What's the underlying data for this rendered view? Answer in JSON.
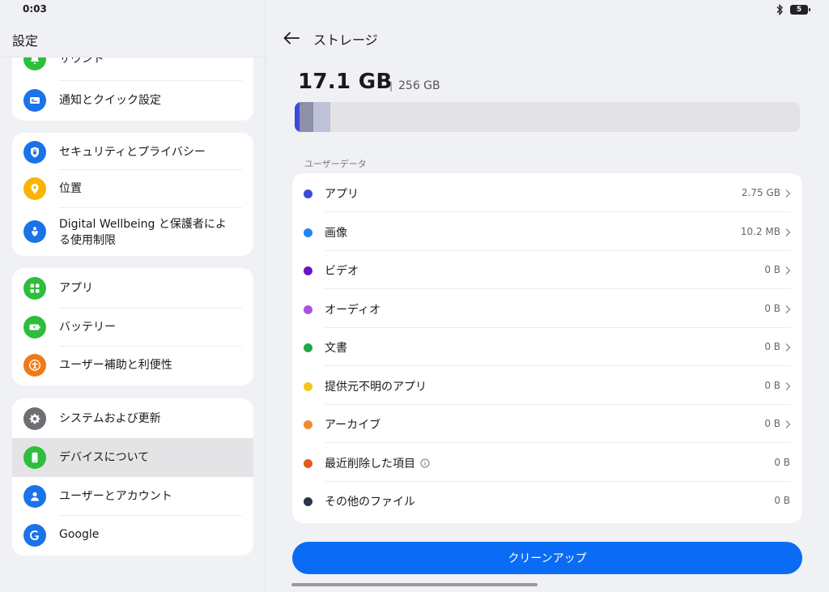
{
  "status_bar": {
    "time": "0:03",
    "battery": "5"
  },
  "left": {
    "title": "設定",
    "cards": [
      {
        "items": [
          {
            "label": "サウンド",
            "icon": "bell-icon",
            "color": "#2dbe3c"
          },
          {
            "label": "通知とクイック設定",
            "icon": "notification-icon",
            "color": "#1a73e8"
          }
        ]
      },
      {
        "items": [
          {
            "label": "セキュリティとプライバシー",
            "icon": "shield-icon",
            "color": "#1a73e8"
          },
          {
            "label": "位置",
            "icon": "location-icon",
            "color": "#f7b500"
          },
          {
            "label": "Digital Wellbeing と保護者による使用制限",
            "icon": "wellbeing-icon",
            "color": "#1a73e8"
          }
        ]
      },
      {
        "items": [
          {
            "label": "アプリ",
            "icon": "apps-icon",
            "color": "#2dbe3c"
          },
          {
            "label": "バッテリー",
            "icon": "battery-icon",
            "color": "#2dbe3c"
          },
          {
            "label": "ユーザー補助と利便性",
            "icon": "accessibility-icon",
            "color": "#f07a1a"
          }
        ]
      },
      {
        "items": [
          {
            "label": "システムおよび更新",
            "icon": "gear-icon",
            "color": "#6e6e73"
          },
          {
            "label": "デバイスについて",
            "icon": "phone-icon",
            "color": "#2dbe3c"
          },
          {
            "label": "ユーザーとアカウント",
            "icon": "person-icon",
            "color": "#1a73e8"
          },
          {
            "label": "Google",
            "icon": "google-icon",
            "color": "#1a73e8"
          }
        ]
      }
    ]
  },
  "right": {
    "title": "ストレージ",
    "used": "17.1 GB",
    "separator": "|",
    "total": "256 GB",
    "section_label": "ユーザーデータ",
    "items": [
      {
        "label": "アプリ",
        "size": "2.75 GB",
        "color": "#3a4bd8",
        "chevron": true
      },
      {
        "label": "画像",
        "size": "10.2 MB",
        "color": "#1f86f0",
        "chevron": true
      },
      {
        "label": "ビデオ",
        "size": "0 B",
        "color": "#6b12c9",
        "chevron": true
      },
      {
        "label": "オーディオ",
        "size": "0 B",
        "color": "#a854e0",
        "chevron": true
      },
      {
        "label": "文書",
        "size": "0 B",
        "color": "#1ea84a",
        "chevron": true
      },
      {
        "label": "提供元不明のアプリ",
        "size": "0 B",
        "color": "#f5c518",
        "chevron": true
      },
      {
        "label": "アーカイブ",
        "size": "0 B",
        "color": "#f38a30",
        "chevron": true
      },
      {
        "label": "最近削除した項目",
        "size": "0 B",
        "color": "#e25a1c",
        "chevron": false,
        "info": true
      },
      {
        "label": "その他のファイル",
        "size": "0 B",
        "color": "#2c3448",
        "chevron": false
      }
    ],
    "cleanup_label": "クリーンアップ"
  }
}
